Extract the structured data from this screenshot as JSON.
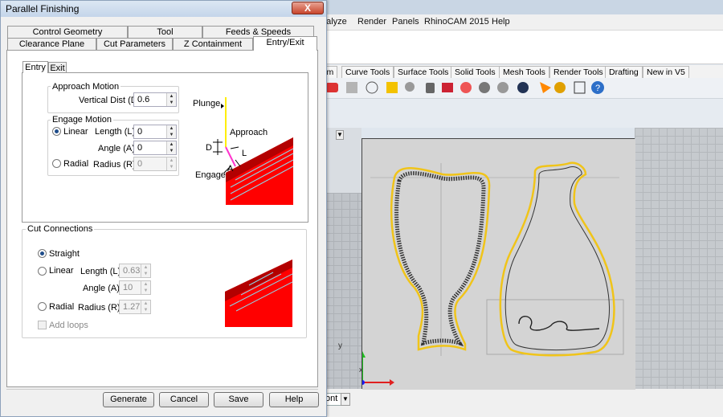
{
  "background_app": {
    "menu": [
      "nalyze",
      "Render",
      "Panels",
      "RhinoCAM 2015",
      "Help"
    ],
    "toolbar_tabs": [
      "rm",
      "Curve Tools",
      "Surface Tools",
      "Solid Tools",
      "Mesh Tools",
      "Render Tools",
      "Drafting",
      "New in V5"
    ],
    "viewport_label": "p",
    "bottom_field": "ont",
    "axis_y": "y",
    "axis_x": "x"
  },
  "dialog": {
    "title": "Parallel Finishing",
    "close_label": "X",
    "tabs_row1": [
      "Control Geometry",
      "Tool",
      "Feeds & Speeds"
    ],
    "tabs_row2": [
      "Clearance Plane",
      "Cut Parameters",
      "Z Containment",
      "Entry/Exit"
    ],
    "active_tab": "Entry/Exit",
    "subtabs": [
      "Entry",
      "Exit"
    ],
    "active_subtab": "Entry",
    "approach": {
      "group_label": "Approach Motion",
      "vertical_dist_label": "Vertical Dist (D):",
      "vertical_dist_value": "0.6"
    },
    "engage": {
      "group_label": "Engage Motion",
      "linear_label": "Linear",
      "radial_label": "Radial",
      "selected": "Linear",
      "length_label": "Length (L)",
      "length_value": "0",
      "angle_label": "Angle (A)",
      "angle_value": "0",
      "radius_label": "Radius (R)",
      "radius_value": "0"
    },
    "diagram": {
      "plunge": "Plunge",
      "approach": "Approach",
      "engage": "Engage",
      "d": "D",
      "l": "L",
      "a": "A",
      "colors": {
        "stock": "#ff0000",
        "stock_dark": "#b30000",
        "tool": "#ffee00",
        "path": "#ff33cc"
      }
    },
    "cut_connections": {
      "group_label": "Cut Connections",
      "straight_label": "Straight",
      "linear_label": "Linear",
      "radial_label": "Radial",
      "selected": "Straight",
      "length_label": "Length (L)",
      "length_value": "0.635",
      "angle_label": "Angle (A)",
      "angle_value": "10",
      "radius_label": "Radius (R)",
      "radius_value": "1.27",
      "add_loops_label": "Add loops"
    },
    "buttons": {
      "generate": "Generate",
      "cancel": "Cancel",
      "save": "Save",
      "help": "Help"
    }
  }
}
